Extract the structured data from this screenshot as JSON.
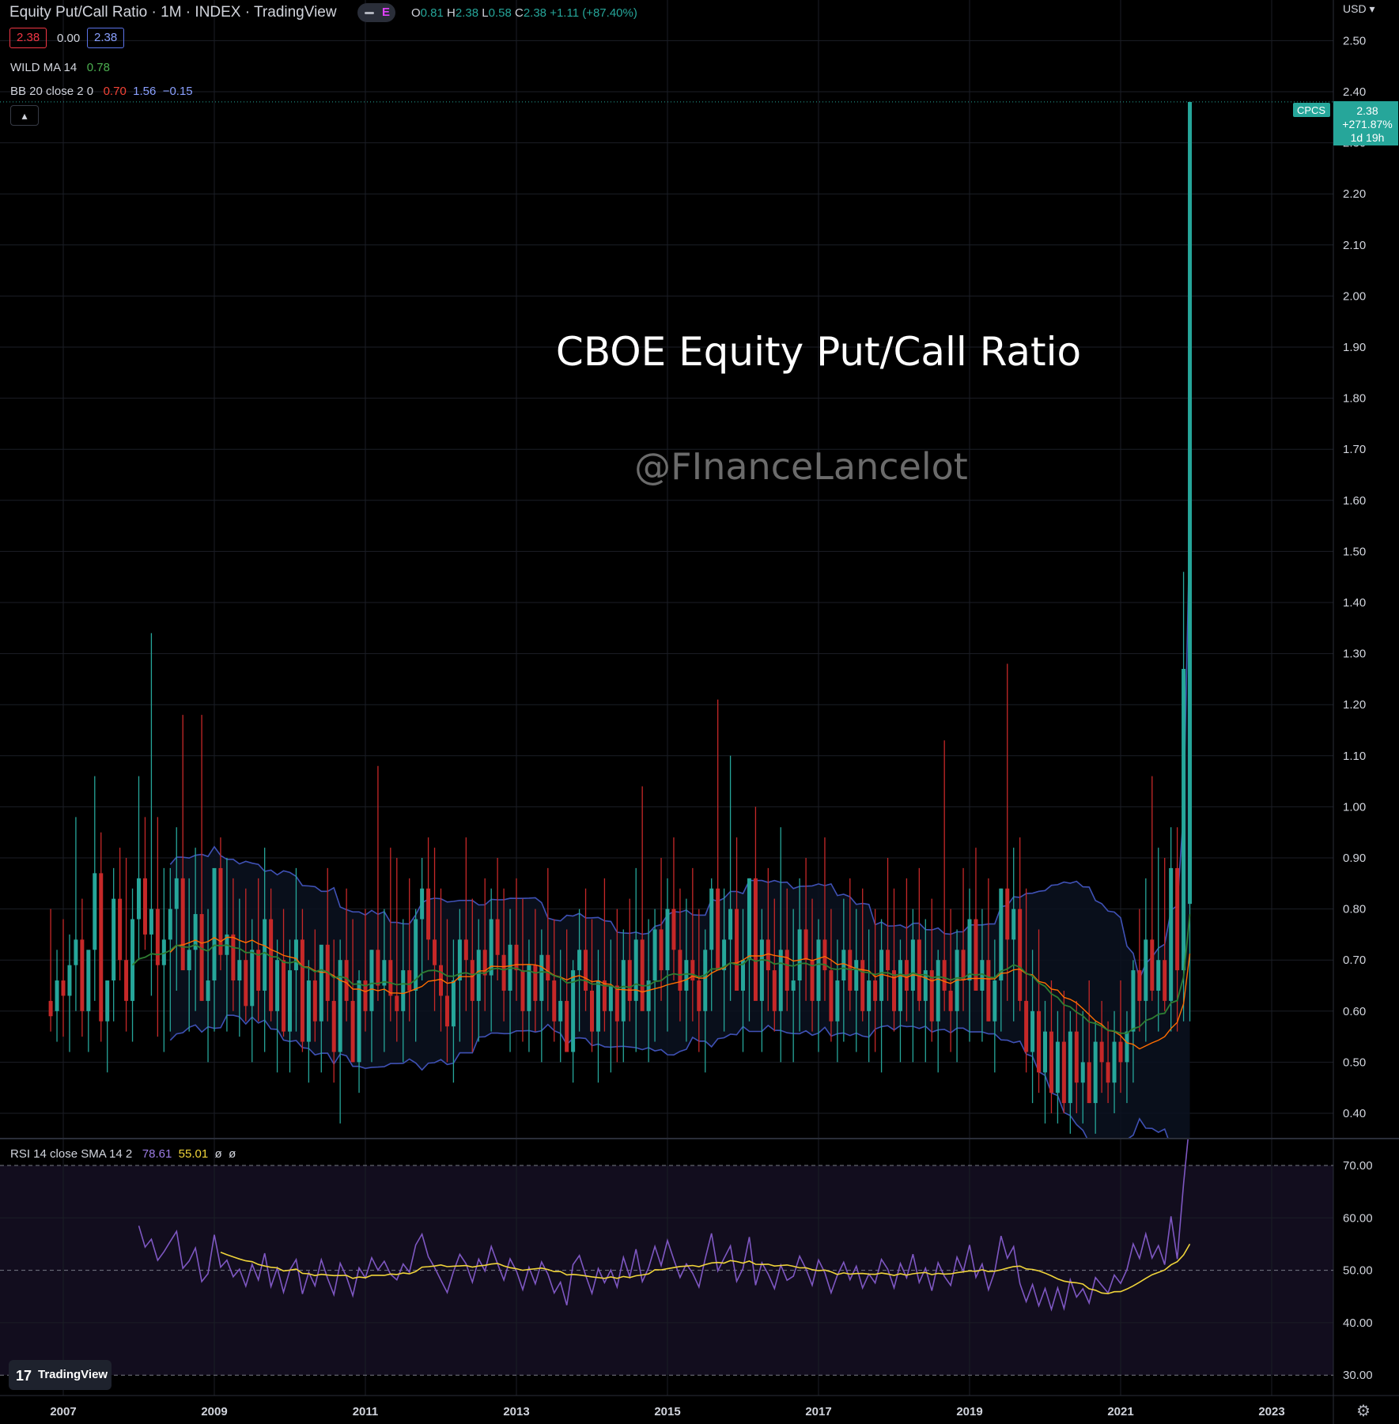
{
  "header": {
    "title": "Equity Put/Call Ratio · 1M · INDEX · TradingView",
    "pill_letter": "E",
    "ohlc": {
      "o_label": "O",
      "o": "0.81",
      "h_label": "H",
      "h": "2.38",
      "l_label": "L",
      "l": "0.58",
      "c_label": "C",
      "c": "2.38",
      "change": "+1.11 (+87.40%)"
    },
    "bid": "2.38",
    "spread": "0.00",
    "ask": "2.38",
    "collapse_icon": "▴",
    "indicators": [
      {
        "name": "WILD MA 14",
        "values": [
          "0.78"
        ],
        "colors": [
          "#4caf50"
        ]
      },
      {
        "name": "BB 20 close 2 0",
        "values": [
          "0.70",
          "1.56",
          "−0.15"
        ],
        "colors": [
          "#f44336",
          "#7b8cff",
          "#7b8cff"
        ]
      }
    ]
  },
  "price_axis": {
    "currency": "USD",
    "labels": [
      "2.50",
      "2.40",
      "2.30",
      "2.20",
      "2.10",
      "2.00",
      "1.90",
      "1.80",
      "1.70",
      "1.60",
      "1.50",
      "1.40",
      "1.30",
      "1.20",
      "1.10",
      "1.00",
      "0.90",
      "0.80",
      "0.70",
      "0.60",
      "0.50",
      "0.40"
    ],
    "last_tag": {
      "symbol": "CPCS",
      "price": "2.38",
      "change": "+271.87%",
      "countdown": "1d 19h"
    }
  },
  "time_axis": {
    "labels": [
      "2007",
      "2009",
      "2011",
      "2013",
      "2015",
      "2017",
      "2019",
      "2021",
      "2023"
    ]
  },
  "rsi": {
    "legend_name": "RSI 14 close SMA 14 2",
    "rsi_value": "78.61",
    "sma_value": "55.01",
    "extra": [
      "ø",
      "ø"
    ],
    "axis_labels": [
      "70.00",
      "60.00",
      "50.00",
      "40.00",
      "30.00"
    ]
  },
  "annotations": {
    "title": "CBOE Equity Put/Call Ratio",
    "watermark": "@FInanceLancelot"
  },
  "branding": {
    "logo": "17",
    "name": "TradingView",
    "settings_icon": "⚙"
  },
  "colors": {
    "up": "#26a69a",
    "down": "#c62828",
    "bb": "#3f51b5",
    "bb_mid": "#ff6d00",
    "wild": "#2e7d32",
    "rsi": "#7e57c2",
    "rsi_sma": "#f0d43a"
  },
  "chart_data": {
    "type": "candlestick",
    "title": "CBOE Equity Put/Call Ratio",
    "x_range": [
      "2006-11",
      "2023-01"
    ],
    "y_range": [
      0.37,
      2.55
    ],
    "y_scale": "linear",
    "grid": true,
    "series_candles": {
      "start": "2006-11",
      "interval": "1M",
      "ohlc": [
        [
          0.62,
          0.8,
          0.56,
          0.59
        ],
        [
          0.6,
          0.72,
          0.54,
          0.66
        ],
        [
          0.66,
          0.78,
          0.55,
          0.63
        ],
        [
          0.63,
          0.75,
          0.52,
          0.69
        ],
        [
          0.69,
          0.98,
          0.6,
          0.74
        ],
        [
          0.74,
          0.82,
          0.55,
          0.6
        ],
        [
          0.6,
          0.7,
          0.52,
          0.72
        ],
        [
          0.72,
          1.06,
          0.62,
          0.87
        ],
        [
          0.87,
          0.95,
          0.54,
          0.58
        ],
        [
          0.58,
          0.66,
          0.48,
          0.66
        ],
        [
          0.66,
          0.88,
          0.58,
          0.82
        ],
        [
          0.82,
          0.92,
          0.66,
          0.7
        ],
        [
          0.7,
          0.9,
          0.56,
          0.62
        ],
        [
          0.62,
          0.84,
          0.54,
          0.78
        ],
        [
          0.78,
          1.06,
          0.7,
          0.86
        ],
        [
          0.86,
          0.98,
          0.72,
          0.75
        ],
        [
          0.75,
          1.34,
          0.63,
          0.8
        ],
        [
          0.8,
          0.98,
          0.55,
          0.69
        ],
        [
          0.69,
          0.88,
          0.52,
          0.74
        ],
        [
          0.74,
          0.88,
          0.56,
          0.8
        ],
        [
          0.8,
          0.96,
          0.64,
          0.86
        ],
        [
          0.86,
          1.18,
          0.7,
          0.68
        ],
        [
          0.68,
          0.86,
          0.56,
          0.72
        ],
        [
          0.72,
          0.92,
          0.6,
          0.79
        ],
        [
          0.79,
          1.18,
          0.62,
          0.62
        ],
        [
          0.62,
          0.8,
          0.5,
          0.66
        ],
        [
          0.66,
          0.86,
          0.56,
          0.88
        ],
        [
          0.88,
          0.94,
          0.68,
          0.71
        ],
        [
          0.71,
          0.9,
          0.56,
          0.75
        ],
        [
          0.75,
          0.86,
          0.6,
          0.66
        ],
        [
          0.66,
          0.82,
          0.55,
          0.7
        ],
        [
          0.7,
          0.84,
          0.58,
          0.61
        ],
        [
          0.61,
          0.78,
          0.5,
          0.72
        ],
        [
          0.72,
          0.86,
          0.58,
          0.64
        ],
        [
          0.64,
          0.92,
          0.52,
          0.78
        ],
        [
          0.78,
          0.84,
          0.58,
          0.6
        ],
        [
          0.6,
          0.74,
          0.48,
          0.7
        ],
        [
          0.7,
          0.8,
          0.55,
          0.56
        ],
        [
          0.56,
          0.74,
          0.48,
          0.68
        ],
        [
          0.68,
          0.88,
          0.56,
          0.74
        ],
        [
          0.74,
          0.8,
          0.52,
          0.54
        ],
        [
          0.54,
          0.7,
          0.46,
          0.66
        ],
        [
          0.66,
          0.76,
          0.54,
          0.58
        ],
        [
          0.58,
          0.7,
          0.48,
          0.73
        ],
        [
          0.73,
          0.88,
          0.58,
          0.62
        ],
        [
          0.62,
          0.74,
          0.46,
          0.52
        ],
        [
          0.52,
          0.74,
          0.38,
          0.7
        ],
        [
          0.7,
          0.84,
          0.58,
          0.62
        ],
        [
          0.62,
          0.78,
          0.5,
          0.5
        ],
        [
          0.5,
          0.68,
          0.44,
          0.66
        ],
        [
          0.66,
          0.8,
          0.56,
          0.6
        ],
        [
          0.6,
          0.72,
          0.5,
          0.72
        ],
        [
          0.72,
          1.08,
          0.62,
          0.65
        ],
        [
          0.65,
          0.8,
          0.52,
          0.7
        ],
        [
          0.7,
          0.92,
          0.58,
          0.63
        ],
        [
          0.63,
          0.9,
          0.54,
          0.6
        ],
        [
          0.6,
          0.78,
          0.5,
          0.68
        ],
        [
          0.68,
          0.86,
          0.58,
          0.64
        ],
        [
          0.64,
          0.8,
          0.54,
          0.78
        ],
        [
          0.78,
          0.9,
          0.66,
          0.84
        ],
        [
          0.84,
          0.94,
          0.7,
          0.74
        ],
        [
          0.74,
          0.92,
          0.6,
          0.69
        ],
        [
          0.69,
          0.84,
          0.56,
          0.63
        ],
        [
          0.63,
          0.78,
          0.5,
          0.57
        ],
        [
          0.57,
          0.74,
          0.46,
          0.66
        ],
        [
          0.66,
          0.8,
          0.54,
          0.74
        ],
        [
          0.74,
          0.94,
          0.6,
          0.7
        ],
        [
          0.7,
          0.82,
          0.52,
          0.62
        ],
        [
          0.62,
          0.78,
          0.54,
          0.72
        ],
        [
          0.72,
          0.86,
          0.6,
          0.67
        ],
        [
          0.67,
          0.84,
          0.56,
          0.78
        ],
        [
          0.78,
          0.9,
          0.66,
          0.71
        ],
        [
          0.71,
          0.84,
          0.58,
          0.64
        ],
        [
          0.64,
          0.8,
          0.52,
          0.73
        ],
        [
          0.73,
          0.86,
          0.62,
          0.68
        ],
        [
          0.68,
          0.82,
          0.54,
          0.6
        ],
        [
          0.6,
          0.74,
          0.52,
          0.69
        ],
        [
          0.69,
          0.8,
          0.56,
          0.62
        ],
        [
          0.62,
          0.76,
          0.5,
          0.71
        ],
        [
          0.71,
          0.88,
          0.6,
          0.66
        ],
        [
          0.66,
          0.78,
          0.54,
          0.58
        ],
        [
          0.58,
          0.72,
          0.5,
          0.62
        ],
        [
          0.62,
          0.76,
          0.52,
          0.52
        ],
        [
          0.52,
          0.7,
          0.46,
          0.68
        ],
        [
          0.68,
          0.8,
          0.56,
          0.72
        ],
        [
          0.72,
          0.84,
          0.6,
          0.64
        ],
        [
          0.64,
          0.78,
          0.52,
          0.56
        ],
        [
          0.56,
          0.72,
          0.46,
          0.66
        ],
        [
          0.66,
          0.86,
          0.56,
          0.6
        ],
        [
          0.6,
          0.74,
          0.48,
          0.65
        ],
        [
          0.65,
          0.8,
          0.5,
          0.58
        ],
        [
          0.58,
          0.76,
          0.5,
          0.7
        ],
        [
          0.7,
          0.82,
          0.58,
          0.62
        ],
        [
          0.62,
          0.88,
          0.52,
          0.74
        ],
        [
          0.74,
          1.04,
          0.62,
          0.6
        ],
        [
          0.6,
          0.78,
          0.5,
          0.66
        ],
        [
          0.66,
          0.8,
          0.54,
          0.76
        ],
        [
          0.76,
          0.9,
          0.62,
          0.68
        ],
        [
          0.68,
          0.86,
          0.56,
          0.8
        ],
        [
          0.8,
          0.94,
          0.66,
          0.72
        ],
        [
          0.72,
          0.84,
          0.58,
          0.64
        ],
        [
          0.64,
          0.82,
          0.54,
          0.7
        ],
        [
          0.7,
          0.88,
          0.58,
          0.66
        ],
        [
          0.66,
          0.8,
          0.52,
          0.6
        ],
        [
          0.6,
          0.76,
          0.48,
          0.72
        ],
        [
          0.72,
          0.86,
          0.6,
          0.84
        ],
        [
          0.84,
          1.21,
          0.7,
          0.68
        ],
        [
          0.68,
          0.84,
          0.56,
          0.74
        ],
        [
          0.74,
          1.1,
          0.62,
          0.8
        ],
        [
          0.8,
          0.94,
          0.64,
          0.64
        ],
        [
          0.64,
          0.8,
          0.52,
          0.7
        ],
        [
          0.7,
          0.86,
          0.58,
          0.86
        ],
        [
          0.86,
          1.0,
          0.7,
          0.62
        ],
        [
          0.62,
          0.8,
          0.52,
          0.74
        ],
        [
          0.74,
          0.88,
          0.6,
          0.68
        ],
        [
          0.68,
          0.82,
          0.56,
          0.6
        ],
        [
          0.6,
          0.96,
          0.5,
          0.72
        ],
        [
          0.72,
          0.84,
          0.6,
          0.64
        ],
        [
          0.64,
          0.8,
          0.5,
          0.66
        ],
        [
          0.66,
          0.86,
          0.56,
          0.76
        ],
        [
          0.76,
          0.9,
          0.62,
          0.7
        ],
        [
          0.7,
          0.82,
          0.56,
          0.62
        ],
        [
          0.62,
          0.78,
          0.52,
          0.74
        ],
        [
          0.74,
          0.94,
          0.62,
          0.68
        ],
        [
          0.68,
          0.8,
          0.54,
          0.58
        ],
        [
          0.58,
          0.74,
          0.5,
          0.66
        ],
        [
          0.66,
          0.82,
          0.54,
          0.72
        ],
        [
          0.72,
          0.86,
          0.6,
          0.64
        ],
        [
          0.64,
          0.8,
          0.52,
          0.7
        ],
        [
          0.7,
          0.84,
          0.58,
          0.6
        ],
        [
          0.6,
          0.76,
          0.5,
          0.66
        ],
        [
          0.66,
          0.8,
          0.52,
          0.62
        ],
        [
          0.62,
          0.78,
          0.48,
          0.72
        ],
        [
          0.72,
          0.9,
          0.62,
          0.68
        ],
        [
          0.68,
          0.84,
          0.56,
          0.6
        ],
        [
          0.6,
          0.74,
          0.5,
          0.7
        ],
        [
          0.7,
          0.86,
          0.58,
          0.64
        ],
        [
          0.64,
          0.8,
          0.5,
          0.74
        ],
        [
          0.74,
          0.88,
          0.6,
          0.62
        ],
        [
          0.62,
          0.78,
          0.5,
          0.68
        ],
        [
          0.68,
          0.82,
          0.54,
          0.58
        ],
        [
          0.58,
          0.72,
          0.48,
          0.7
        ],
        [
          0.7,
          1.13,
          0.6,
          0.64
        ],
        [
          0.64,
          0.8,
          0.52,
          0.6
        ],
        [
          0.6,
          0.76,
          0.5,
          0.72
        ],
        [
          0.72,
          0.88,
          0.6,
          0.66
        ],
        [
          0.66,
          0.84,
          0.54,
          0.78
        ],
        [
          0.78,
          0.92,
          0.64,
          0.64
        ],
        [
          0.64,
          0.8,
          0.54,
          0.7
        ],
        [
          0.7,
          0.86,
          0.58,
          0.58
        ],
        [
          0.58,
          0.74,
          0.48,
          0.66
        ],
        [
          0.66,
          0.84,
          0.56,
          0.84
        ],
        [
          0.84,
          1.28,
          0.62,
          0.74
        ],
        [
          0.74,
          0.92,
          0.58,
          0.8
        ],
        [
          0.8,
          0.94,
          0.6,
          0.62
        ],
        [
          0.62,
          0.84,
          0.48,
          0.52
        ],
        [
          0.52,
          0.72,
          0.42,
          0.6
        ],
        [
          0.6,
          0.76,
          0.44,
          0.48
        ],
        [
          0.48,
          0.62,
          0.38,
          0.56
        ],
        [
          0.56,
          0.66,
          0.4,
          0.44
        ],
        [
          0.44,
          0.6,
          0.38,
          0.54
        ],
        [
          0.54,
          0.64,
          0.4,
          0.42
        ],
        [
          0.42,
          0.6,
          0.36,
          0.56
        ],
        [
          0.56,
          0.62,
          0.4,
          0.46
        ],
        [
          0.46,
          0.6,
          0.38,
          0.5
        ],
        [
          0.5,
          0.66,
          0.42,
          0.42
        ],
        [
          0.42,
          0.58,
          0.36,
          0.54
        ],
        [
          0.54,
          0.62,
          0.44,
          0.5
        ],
        [
          0.5,
          0.58,
          0.42,
          0.46
        ],
        [
          0.46,
          0.6,
          0.4,
          0.54
        ],
        [
          0.54,
          0.66,
          0.44,
          0.5
        ],
        [
          0.5,
          0.6,
          0.42,
          0.56
        ],
        [
          0.56,
          0.7,
          0.46,
          0.68
        ],
        [
          0.68,
          0.8,
          0.56,
          0.62
        ],
        [
          0.62,
          0.86,
          0.54,
          0.74
        ],
        [
          0.74,
          1.06,
          0.62,
          0.64
        ],
        [
          0.64,
          0.92,
          0.56,
          0.7
        ],
        [
          0.7,
          0.9,
          0.6,
          0.62
        ],
        [
          0.62,
          0.96,
          0.56,
          0.88
        ],
        [
          0.88,
          0.96,
          0.56,
          0.68
        ],
        [
          0.68,
          1.46,
          0.58,
          1.27
        ],
        [
          0.81,
          2.38,
          0.58,
          2.38
        ]
      ]
    },
    "series": [
      {
        "name": "WILD MA 14",
        "last": 0.78
      },
      {
        "name": "BB 20 close 2 0",
        "basis_last": 0.7,
        "upper_last": 1.56,
        "lower_last": -0.15
      }
    ],
    "rsi": {
      "y_range": [
        27,
        77
      ],
      "levels": [
        30,
        50,
        70
      ],
      "rsi_last": 78.61,
      "sma_last": 55.01
    }
  }
}
